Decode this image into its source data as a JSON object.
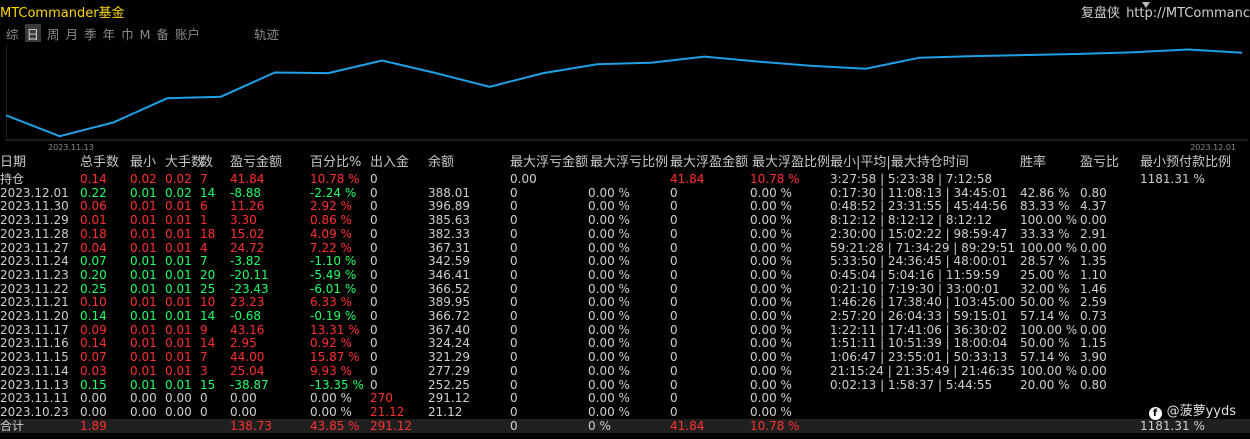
{
  "app": {
    "title": "MTCommander基金"
  },
  "topright": {
    "label": "复盘侠",
    "url": "http://MTCommanc"
  },
  "toolbar": {
    "items": [
      "综",
      "日",
      "周",
      "月",
      "季",
      "年",
      "巾",
      "M",
      "备",
      "账户"
    ],
    "active_index": 1,
    "trail": "轨迹"
  },
  "chart_data": {
    "type": "line",
    "x_labels": [
      "2023.11.13",
      "2023.12.01"
    ],
    "series": [
      {
        "values": [
          290,
          252,
          277,
          321,
          324,
          368,
          367,
          390,
          367,
          342,
          367,
          383,
          386,
          397,
          388,
          380,
          375,
          395,
          398,
          400,
          402,
          405,
          410,
          404
        ]
      }
    ],
    "ylim": [
      245,
      420
    ],
    "color": "#1ea0e6"
  },
  "table": {
    "headers": [
      "日期",
      "总手数",
      "最小",
      "大手数",
      "数",
      "盈亏金额",
      "百分比%",
      "出入金",
      "余额",
      "最大浮亏金额",
      "最大浮亏比例",
      "最大浮盈金额",
      "最大浮盈比例",
      "最小|平均|最大持仓时间",
      "胜率",
      "盈亏比",
      "最小预付款比例"
    ],
    "rows": [
      {
        "date": "持仓",
        "lots": "0.14",
        "min": "0.02",
        "max": "0.02",
        "n": "7",
        "pnl": "41.84",
        "pct": "10.78 %",
        "io": "0",
        "bal": "",
        "fl": "0.00",
        "flp": "",
        "fp": "41.84",
        "fpp": "10.78 %",
        "time": "3:27:58 | 5:23:38 | 7:12:58",
        "win": "",
        "pf": "",
        "margin": "1181.31 %",
        "color": "red"
      },
      {
        "date": "2023.12.01",
        "lots": "0.22",
        "min": "0.01",
        "max": "0.02",
        "n": "14",
        "pnl": "-8.88",
        "pct": "-2.24 %",
        "io": "0",
        "bal": "388.01",
        "fl": "0",
        "flp": "0.00 %",
        "fp": "0",
        "fpp": "0.00 %",
        "time": "0:17:30 | 11:08:13 | 34:45:01",
        "win": "42.86 %",
        "pf": "0.80",
        "margin": "",
        "color": "green"
      },
      {
        "date": "2023.11.30",
        "lots": "0.06",
        "min": "0.01",
        "max": "0.01",
        "n": "6",
        "pnl": "11.26",
        "pct": "2.92 %",
        "io": "0",
        "bal": "396.89",
        "fl": "0",
        "flp": "0.00 %",
        "fp": "0",
        "fpp": "0.00 %",
        "time": "0:48:52 | 23:31:55 | 45:44:56",
        "win": "83.33 %",
        "pf": "4.37",
        "margin": "",
        "color": "red"
      },
      {
        "date": "2023.11.29",
        "lots": "0.01",
        "min": "0.01",
        "max": "0.01",
        "n": "1",
        "pnl": "3.30",
        "pct": "0.86 %",
        "io": "0",
        "bal": "385.63",
        "fl": "0",
        "flp": "0.00 %",
        "fp": "0",
        "fpp": "0.00 %",
        "time": "8:12:12 | 8:12:12 | 8:12:12",
        "win": "100.00 %",
        "pf": "0.00",
        "margin": "",
        "color": "red"
      },
      {
        "date": "2023.11.28",
        "lots": "0.18",
        "min": "0.01",
        "max": "0.01",
        "n": "18",
        "pnl": "15.02",
        "pct": "4.09 %",
        "io": "0",
        "bal": "382.33",
        "fl": "0",
        "flp": "0.00 %",
        "fp": "0",
        "fpp": "0.00 %",
        "time": "2:30:00 | 15:02:22 | 98:59:47",
        "win": "33.33 %",
        "pf": "2.91",
        "margin": "",
        "color": "red"
      },
      {
        "date": "2023.11.27",
        "lots": "0.04",
        "min": "0.01",
        "max": "0.01",
        "n": "4",
        "pnl": "24.72",
        "pct": "7.22 %",
        "io": "0",
        "bal": "367.31",
        "fl": "0",
        "flp": "0.00 %",
        "fp": "0",
        "fpp": "0.00 %",
        "time": "59:21:28 | 71:34:29 | 89:29:51",
        "win": "100.00 %",
        "pf": "0.00",
        "margin": "",
        "color": "red"
      },
      {
        "date": "2023.11.24",
        "lots": "0.07",
        "min": "0.01",
        "max": "0.01",
        "n": "7",
        "pnl": "-3.82",
        "pct": "-1.10 %",
        "io": "0",
        "bal": "342.59",
        "fl": "0",
        "flp": "0.00 %",
        "fp": "0",
        "fpp": "0.00 %",
        "time": "5:33:50 | 24:36:45 | 48:00:01",
        "win": "28.57 %",
        "pf": "1.35",
        "margin": "",
        "color": "green"
      },
      {
        "date": "2023.11.23",
        "lots": "0.20",
        "min": "0.01",
        "max": "0.01",
        "n": "20",
        "pnl": "-20.11",
        "pct": "-5.49 %",
        "io": "0",
        "bal": "346.41",
        "fl": "0",
        "flp": "0.00 %",
        "fp": "0",
        "fpp": "0.00 %",
        "time": "0:45:04 | 5:04:16 | 11:59:59",
        "win": "25.00 %",
        "pf": "1.10",
        "margin": "",
        "color": "green"
      },
      {
        "date": "2023.11.22",
        "lots": "0.25",
        "min": "0.01",
        "max": "0.01",
        "n": "25",
        "pnl": "-23.43",
        "pct": "-6.01 %",
        "io": "0",
        "bal": "366.52",
        "fl": "0",
        "flp": "0.00 %",
        "fp": "0",
        "fpp": "0.00 %",
        "time": "0:21:10 | 7:19:30 | 33:00:01",
        "win": "32.00 %",
        "pf": "1.46",
        "margin": "",
        "color": "green"
      },
      {
        "date": "2023.11.21",
        "lots": "0.10",
        "min": "0.01",
        "max": "0.01",
        "n": "10",
        "pnl": "23.23",
        "pct": "6.33 %",
        "io": "0",
        "bal": "389.95",
        "fl": "0",
        "flp": "0.00 %",
        "fp": "0",
        "fpp": "0.00 %",
        "time": "1:46:26 | 17:38:40 | 103:45:00",
        "win": "50.00 %",
        "pf": "2.59",
        "margin": "",
        "color": "red"
      },
      {
        "date": "2023.11.20",
        "lots": "0.14",
        "min": "0.01",
        "max": "0.01",
        "n": "14",
        "pnl": "-0.68",
        "pct": "-0.19 %",
        "io": "0",
        "bal": "366.72",
        "fl": "0",
        "flp": "0.00 %",
        "fp": "0",
        "fpp": "0.00 %",
        "time": "2:57:20 | 26:04:33 | 59:15:01",
        "win": "57.14 %",
        "pf": "0.73",
        "margin": "",
        "color": "green"
      },
      {
        "date": "2023.11.17",
        "lots": "0.09",
        "min": "0.01",
        "max": "0.01",
        "n": "9",
        "pnl": "43.16",
        "pct": "13.31 %",
        "io": "0",
        "bal": "367.40",
        "fl": "0",
        "flp": "0.00 %",
        "fp": "0",
        "fpp": "0.00 %",
        "time": "1:22:11 | 17:41:06 | 36:30:02",
        "win": "100.00 %",
        "pf": "0.00",
        "margin": "",
        "color": "red"
      },
      {
        "date": "2023.11.16",
        "lots": "0.14",
        "min": "0.01",
        "max": "0.01",
        "n": "14",
        "pnl": "2.95",
        "pct": "0.92 %",
        "io": "0",
        "bal": "324.24",
        "fl": "0",
        "flp": "0.00 %",
        "fp": "0",
        "fpp": "0.00 %",
        "time": "1:51:11 | 10:51:39 | 18:00:04",
        "win": "50.00 %",
        "pf": "1.15",
        "margin": "",
        "color": "red"
      },
      {
        "date": "2023.11.15",
        "lots": "0.07",
        "min": "0.01",
        "max": "0.01",
        "n": "7",
        "pnl": "44.00",
        "pct": "15.87 %",
        "io": "0",
        "bal": "321.29",
        "fl": "0",
        "flp": "0.00 %",
        "fp": "0",
        "fpp": "0.00 %",
        "time": "1:06:47 | 23:55:01 | 50:33:13",
        "win": "57.14 %",
        "pf": "3.90",
        "margin": "",
        "color": "red"
      },
      {
        "date": "2023.11.14",
        "lots": "0.03",
        "min": "0.01",
        "max": "0.01",
        "n": "3",
        "pnl": "25.04",
        "pct": "9.93 %",
        "io": "0",
        "bal": "277.29",
        "fl": "0",
        "flp": "0.00 %",
        "fp": "0",
        "fpp": "0.00 %",
        "time": "21:15:24 | 21:35:49 | 21:46:35",
        "win": "100.00 %",
        "pf": "0.00",
        "margin": "",
        "color": "red"
      },
      {
        "date": "2023.11.13",
        "lots": "0.15",
        "min": "0.01",
        "max": "0.01",
        "n": "15",
        "pnl": "-38.87",
        "pct": "-13.35 %",
        "io": "0",
        "bal": "252.25",
        "fl": "0",
        "flp": "0.00 %",
        "fp": "0",
        "fpp": "0.00 %",
        "time": "0:02:13 | 1:58:37 | 5:44:55",
        "win": "20.00 %",
        "pf": "0.80",
        "margin": "",
        "color": "green"
      },
      {
        "date": "2023.11.11",
        "lots": "0.00",
        "min": "0.00",
        "max": "0.00",
        "n": "0",
        "pnl": "0.00",
        "pct": "0.00 %",
        "io": "270",
        "bal": "291.12",
        "fl": "0",
        "flp": "0.00 %",
        "fp": "0",
        "fpp": "0.00 %",
        "time": "",
        "win": "",
        "pf": "",
        "margin": "",
        "color": "gray",
        "io_red": true
      },
      {
        "date": "2023.10.23",
        "lots": "0.00",
        "min": "0.00",
        "max": "0.00",
        "n": "0",
        "pnl": "0.00",
        "pct": "0.00 %",
        "io": "21.12",
        "bal": "21.12",
        "fl": "0",
        "flp": "0.00 %",
        "fp": "0",
        "fpp": "0.00 %",
        "time": "",
        "win": "",
        "pf": "",
        "margin": "",
        "color": "gray",
        "io_red": true
      }
    ],
    "total": {
      "date": "合计",
      "lots": "1.89",
      "pnl": "138.73",
      "pct": "43.85 %",
      "io": "291.12",
      "bal": "",
      "fl": "0",
      "flp": "0 %",
      "fp": "41.84",
      "fpp": "10.78 %",
      "margin": "1181.31 %"
    }
  },
  "watermark": {
    "text": "@菠萝yyds"
  }
}
